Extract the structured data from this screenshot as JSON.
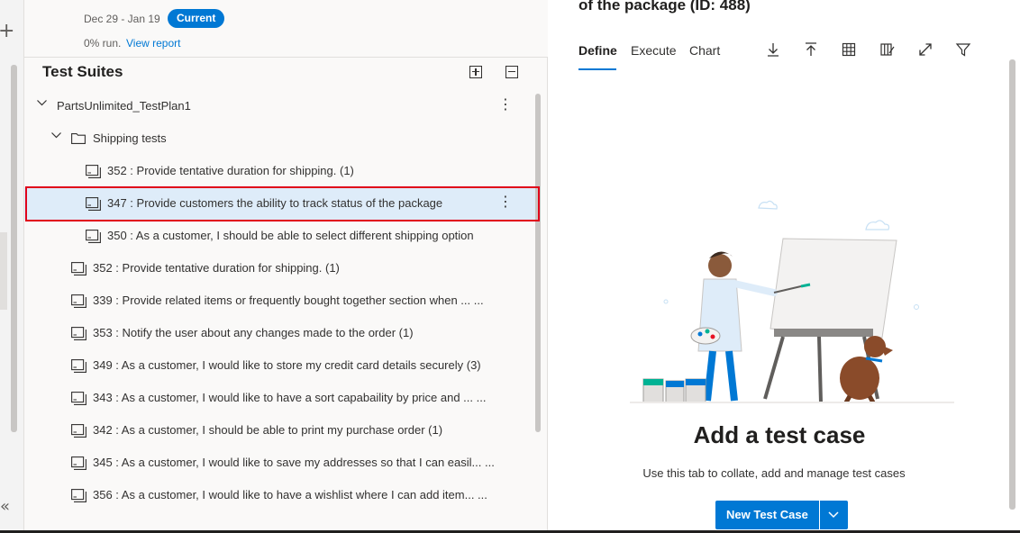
{
  "iteration": {
    "dates": "Dec 29 - Jan 19",
    "badge": "Current",
    "run": "0% run.",
    "report_link": "View report"
  },
  "suites": {
    "title": "Test Suites",
    "tree": [
      {
        "label": "PartsUnlimited_TestPlan1",
        "level": 0,
        "kind": "plan",
        "expanded": true,
        "more": "⋮"
      },
      {
        "label": "Shipping tests",
        "level": 1,
        "kind": "folder",
        "expanded": true
      },
      {
        "label": "352 : Provide tentative duration for shipping. (1)",
        "level": 2,
        "kind": "suite"
      },
      {
        "label": "347 : Provide customers the ability to track status of the package",
        "level": 2,
        "kind": "suite",
        "selected": true,
        "more": "⋮"
      },
      {
        "label": "350 : As a customer, I should be able to select different shipping option",
        "level": 2,
        "kind": "suite"
      },
      {
        "label": "352 : Provide tentative duration for shipping. (1)",
        "level": 1,
        "kind": "suite"
      },
      {
        "label": "339 : Provide related items or frequently bought together section when ... ...",
        "level": 1,
        "kind": "suite"
      },
      {
        "label": "353 : Notify the user about any changes made to the order (1)",
        "level": 1,
        "kind": "suite"
      },
      {
        "label": "349 : As a customer, I would like to store my credit card details securely (3)",
        "level": 1,
        "kind": "suite"
      },
      {
        "label": "343 : As a customer, I would like to have a sort capabaility by price and ... ...",
        "level": 1,
        "kind": "suite"
      },
      {
        "label": "342 : As a customer, I should be able to print my purchase order (1)",
        "level": 1,
        "kind": "suite"
      },
      {
        "label": "345 : As a customer, I would like to save my addresses so that I can easil... ...",
        "level": 1,
        "kind": "suite"
      },
      {
        "label": "356 : As a customer, I would like to have a wishlist where I can add item... ...",
        "level": 1,
        "kind": "suite"
      }
    ]
  },
  "detail": {
    "title": "of the package (ID: 488)",
    "tabs": [
      "Define",
      "Execute",
      "Chart"
    ],
    "active_tab": "Define",
    "toolbar_icons": [
      "download-icon",
      "upload-icon",
      "grid-icon",
      "column-options-icon",
      "fullscreen-icon",
      "filter-icon"
    ],
    "empty_title": "Add a test case",
    "empty_desc": "Use this tab to collate, add and manage test cases",
    "new_button": "New Test Case"
  },
  "colors": {
    "accent": "#0078d4",
    "highlight_box": "#e0001a",
    "selected_row": "#deecf9"
  }
}
